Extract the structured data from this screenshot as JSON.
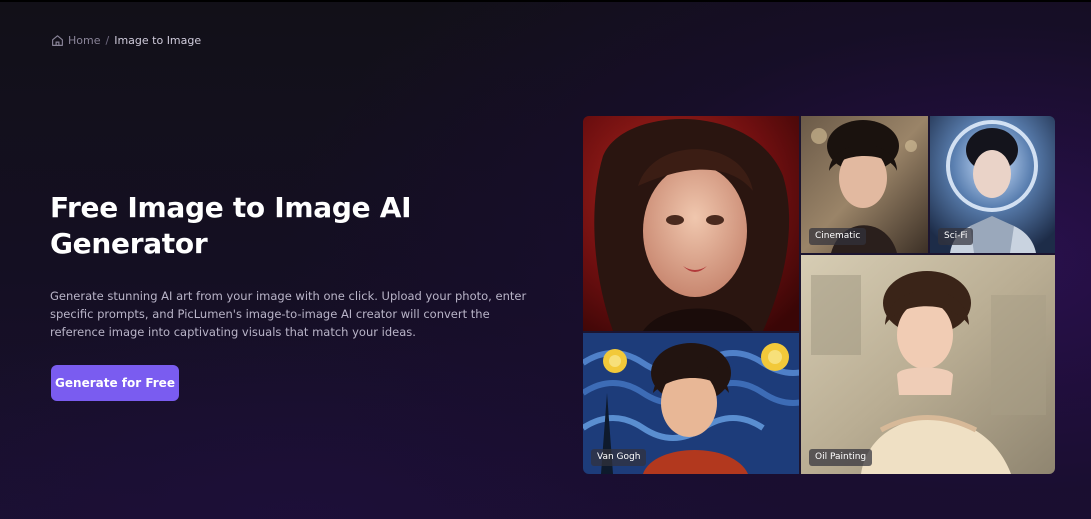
{
  "breadcrumb": {
    "home_icon": "home-icon",
    "home_label": "Home",
    "separator": "/",
    "current": "Image to Image"
  },
  "hero": {
    "title_line1": "Free Image to Image AI",
    "title_line2": "Generator",
    "description": "Generate stunning AI art from your image with one click. Upload your photo, enter specific prompts, and PicLumen's image-to-image AI creator will convert the reference image into captivating visuals that match your ideas.",
    "cta_label": "Generate for Free",
    "cta_color": "#7a5cf0"
  },
  "gallery": {
    "tiles": [
      {
        "label": "",
        "style": "original portrait, red background"
      },
      {
        "label": "Cinematic"
      },
      {
        "label": "Sci-Fi"
      },
      {
        "label": "Van Gogh"
      },
      {
        "label": "Oil Painting"
      }
    ]
  }
}
